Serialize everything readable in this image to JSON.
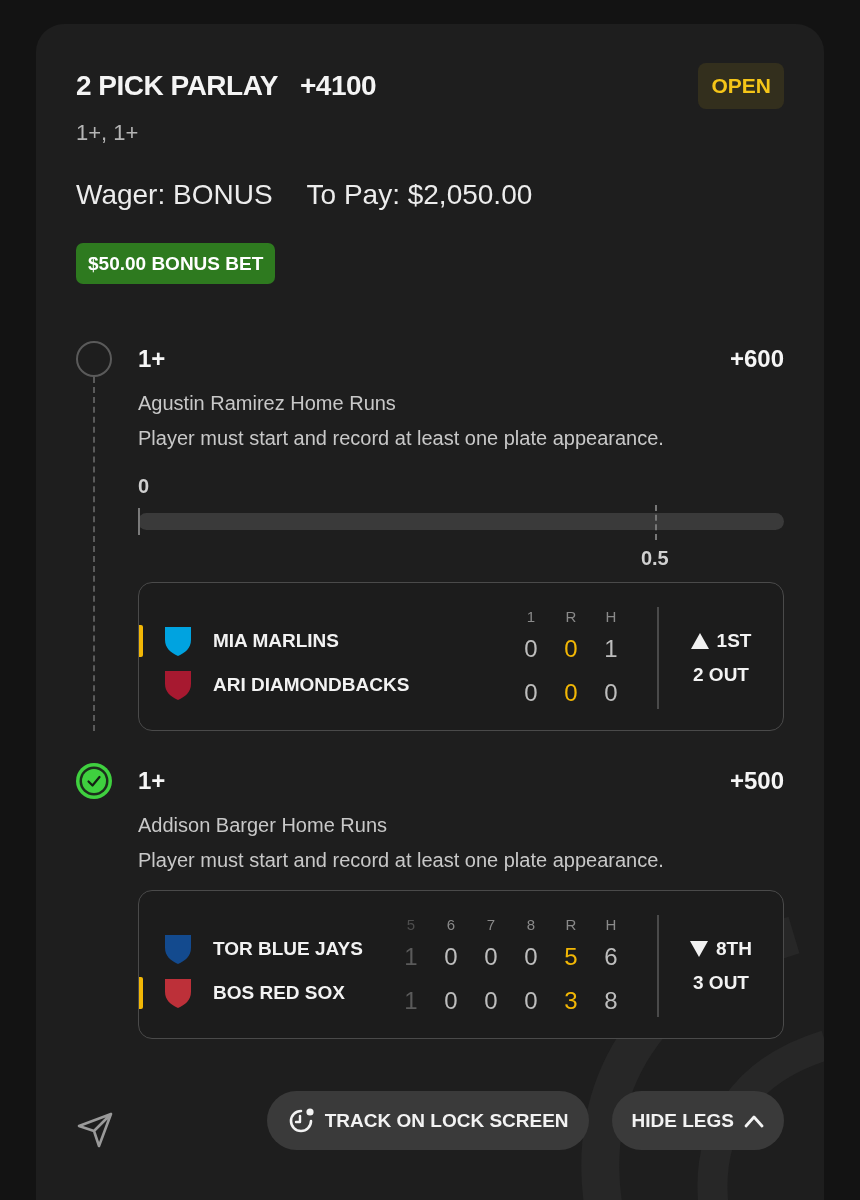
{
  "bet": {
    "title": "2 PICK PARLAY",
    "odds": "+4100",
    "status": "OPEN",
    "legs_summary": "1+, 1+",
    "wager": "Wager: BONUS",
    "to_pay": "To Pay: $2,050.00",
    "bonus_tag": "$50.00 BONUS BET"
  },
  "legs": [
    {
      "line": "1+",
      "odds": "+600",
      "won": false,
      "market": "Agustin Ramirez Home Runs",
      "rule": "Player must start and record at least one plate appearance.",
      "progress": {
        "current": "0",
        "target": "0.5",
        "level": 0
      },
      "game": {
        "columns": [
          {
            "label": "1",
            "kind": "inning",
            "faded": false
          },
          {
            "label": "R",
            "kind": "runs",
            "faded": false
          },
          {
            "label": "H",
            "kind": "hits",
            "faded": false
          }
        ],
        "teams": [
          {
            "name": "MIA MARLINS",
            "color": "#00a3e0",
            "batting": true,
            "scores": [
              "0",
              "0",
              "1"
            ]
          },
          {
            "name": "ARI DIAMONDBACKS",
            "color": "#a71930",
            "batting": false,
            "scores": [
              "0",
              "0",
              "0"
            ]
          }
        ],
        "top_half": true,
        "inning": "1ST",
        "outs": "2 OUT"
      }
    },
    {
      "line": "1+",
      "odds": "+500",
      "won": true,
      "market": "Addison Barger Home Runs",
      "rule": "Player must start and record at least one plate appearance.",
      "game": {
        "columns": [
          {
            "label": "5",
            "kind": "inning",
            "faded": true
          },
          {
            "label": "6",
            "kind": "inning",
            "faded": false
          },
          {
            "label": "7",
            "kind": "inning",
            "faded": false
          },
          {
            "label": "8",
            "kind": "inning",
            "faded": false
          },
          {
            "label": "R",
            "kind": "runs",
            "faded": false
          },
          {
            "label": "H",
            "kind": "hits",
            "faded": false
          }
        ],
        "teams": [
          {
            "name": "TOR BLUE JAYS",
            "color": "#134a8e",
            "batting": false,
            "scores": [
              "1",
              "0",
              "0",
              "0",
              "5",
              "6"
            ]
          },
          {
            "name": "BOS RED SOX",
            "color": "#bd3039",
            "batting": true,
            "scores": [
              "1",
              "0",
              "0",
              "0",
              "3",
              "8"
            ]
          }
        ],
        "top_half": false,
        "inning": "8TH",
        "outs": "3 OUT"
      }
    }
  ],
  "actions": {
    "track_button": "TRACK ON LOCK SCREEN",
    "hide_button": "HIDE LEGS"
  }
}
